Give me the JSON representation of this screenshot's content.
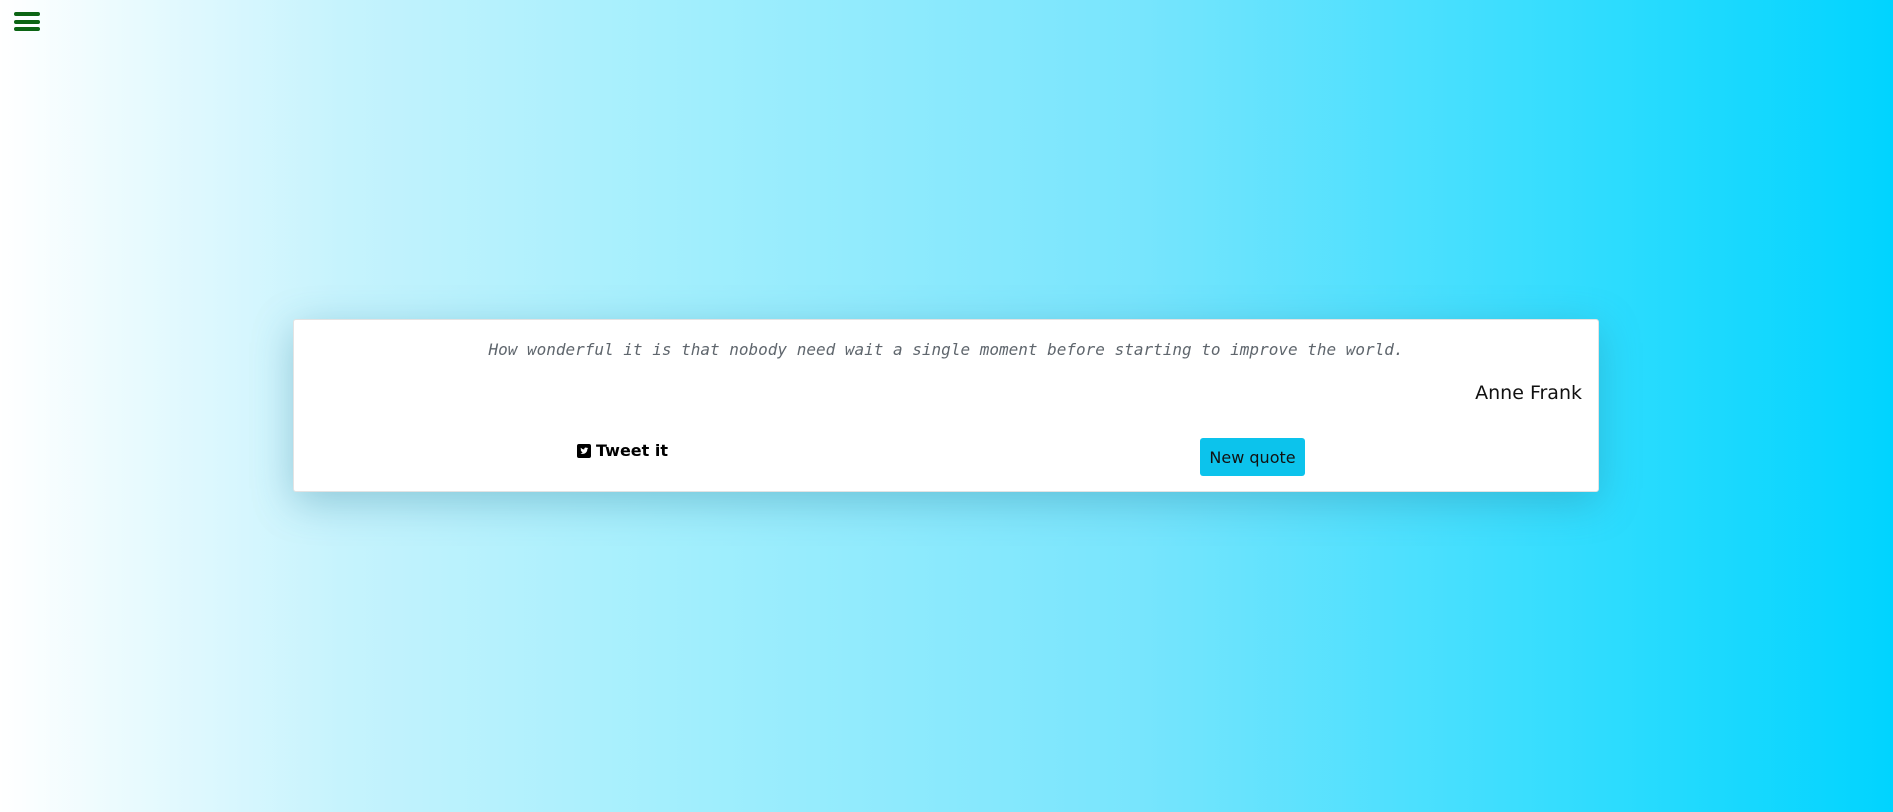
{
  "menu": {
    "icon": "hamburger-menu-icon",
    "color": "#0b6414"
  },
  "quote": {
    "text": "How wonderful it is that nobody need wait a single moment before starting to improve the world.",
    "author": "Anne Frank"
  },
  "actions": {
    "tweet_label": "Tweet it",
    "tweet_icon": "twitter-square-icon",
    "new_quote_label": "New quote",
    "new_quote_color": "#0cc3ec"
  }
}
